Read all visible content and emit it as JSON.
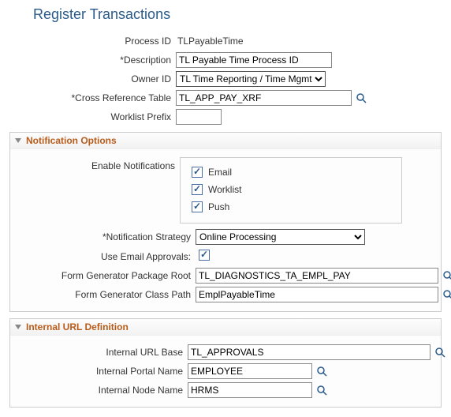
{
  "title": "Register Transactions",
  "form": {
    "process_id_label": "Process ID",
    "process_id_value": "TLPayableTime",
    "description_label": "*Description",
    "description_value": "TL Payable Time Process ID",
    "owner_id_label": "Owner ID",
    "owner_id_value": "TL Time Reporting / Time Mgmt",
    "cross_ref_label": "*Cross Reference Table",
    "cross_ref_value": "TL_APP_PAY_XRF",
    "worklist_prefix_label": "Worklist Prefix",
    "worklist_prefix_value": ""
  },
  "notif": {
    "section_title": "Notification Options",
    "enable_label": "Enable Notifications",
    "email_label": "Email",
    "worklist_label": "Worklist",
    "push_label": "Push",
    "strategy_label": "*Notification Strategy",
    "strategy_value": "Online Processing",
    "use_email_label": "Use Email Approvals:",
    "pkg_root_label": "Form Generator Package Root",
    "pkg_root_value": "TL_DIAGNOSTICS_TA_EMPL_PAY",
    "class_path_label": "Form Generator Class Path",
    "class_path_value": "EmplPayableTime"
  },
  "url": {
    "section_title": "Internal URL Definition",
    "base_label": "Internal URL Base",
    "base_value": "TL_APPROVALS",
    "portal_label": "Internal Portal Name",
    "portal_value": "EMPLOYEE",
    "node_label": "Internal Node Name",
    "node_value": "HRMS"
  }
}
